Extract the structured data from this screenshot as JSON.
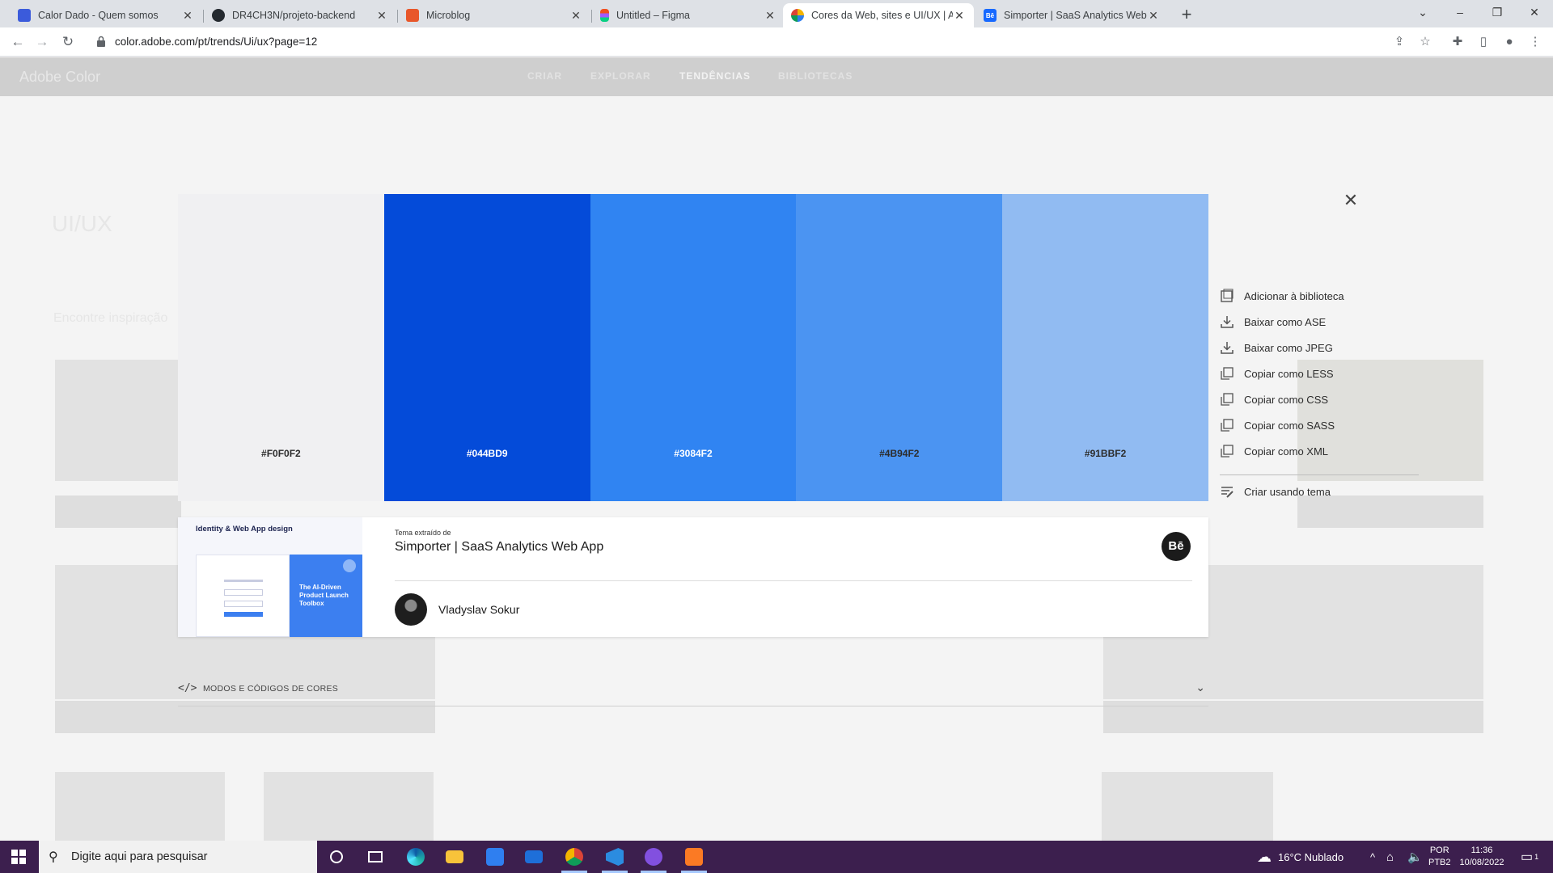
{
  "browser": {
    "tabs": [
      {
        "title": "Calor Dado - Quem somos",
        "icon_color": "#3b5bdb",
        "icon_glyph": "",
        "active": false
      },
      {
        "title": "DR4CH3N/projeto-backend",
        "icon_color": "#24292f",
        "icon_glyph": "",
        "active": false
      },
      {
        "title": "Microblog",
        "icon_color": "#e8572a",
        "icon_glyph": "",
        "active": false
      },
      {
        "title": "Untitled – Figma",
        "icon_color": "#a259ff",
        "icon_glyph": "",
        "active": false
      },
      {
        "title": "Cores da Web, sites e UI/UX | Ad",
        "icon_color": "#2f7ff0",
        "icon_glyph": "",
        "active": true
      },
      {
        "title": "Simporter | SaaS Analytics Web A",
        "icon_color": "#1769ff",
        "icon_glyph": "Bē",
        "active": false
      }
    ],
    "url": "color.adobe.com/pt/trends/Ui/ux?page=12"
  },
  "background_page": {
    "logo": "Adobe Color",
    "nav": [
      "CRIAR",
      "EXPLORAR",
      "TENDÊNCIAS",
      "BIBLIOTECAS"
    ],
    "title": "UI/UX",
    "subtitle": "Encontre inspiração"
  },
  "modal": {
    "swatches": [
      {
        "hex": "#F0F0F2",
        "color": "#F0F0F2",
        "text_color": "#2c2c2c"
      },
      {
        "hex": "#044BD9",
        "color": "#044BD9",
        "text_color": "#ffffff"
      },
      {
        "hex": "#3084F2",
        "color": "#3084F2",
        "text_color": "#ffffff"
      },
      {
        "hex": "#4B94F2",
        "color": "#4B94F2",
        "text_color": "#2c2c2c"
      },
      {
        "hex": "#91BBF2",
        "color": "#91BBF2",
        "text_color": "#2c2c2c"
      }
    ],
    "close_icon": "close-icon",
    "actions": [
      {
        "label": "Adicionar à biblioteca",
        "icon": "library-icon"
      },
      {
        "label": "Baixar como ASE",
        "icon": "download-icon"
      },
      {
        "label": "Baixar como JPEG",
        "icon": "download-icon"
      },
      {
        "label": "Copiar como LESS",
        "icon": "copy-icon"
      },
      {
        "label": "Copiar como CSS",
        "icon": "copy-icon"
      },
      {
        "label": "Copiar como SASS",
        "icon": "copy-icon"
      },
      {
        "label": "Copiar como XML",
        "icon": "copy-icon"
      }
    ],
    "create_action": {
      "label": "Criar usando tema",
      "icon": "create-theme-icon"
    },
    "source": {
      "label": "Tema extraído de",
      "title": "Simporter | SaaS Analytics Web App",
      "author": "Vladyslav Sokur",
      "thumbnail_heading": "Identity & Web App design",
      "thumbnail_banner": "The AI-Driven Product Launch Toolbox",
      "behance_logo": "Bē"
    },
    "color_modes": {
      "code_glyph": "</>",
      "label": "MODOS E CÓDIGOS DE CORES"
    }
  },
  "taskbar": {
    "search_placeholder": "Digite aqui para pesquisar",
    "weather": "16°C  Nublado",
    "language": [
      "POR",
      "PTB2"
    ],
    "time": "11:36",
    "date": "10/08/2022",
    "notification_count": "1"
  }
}
